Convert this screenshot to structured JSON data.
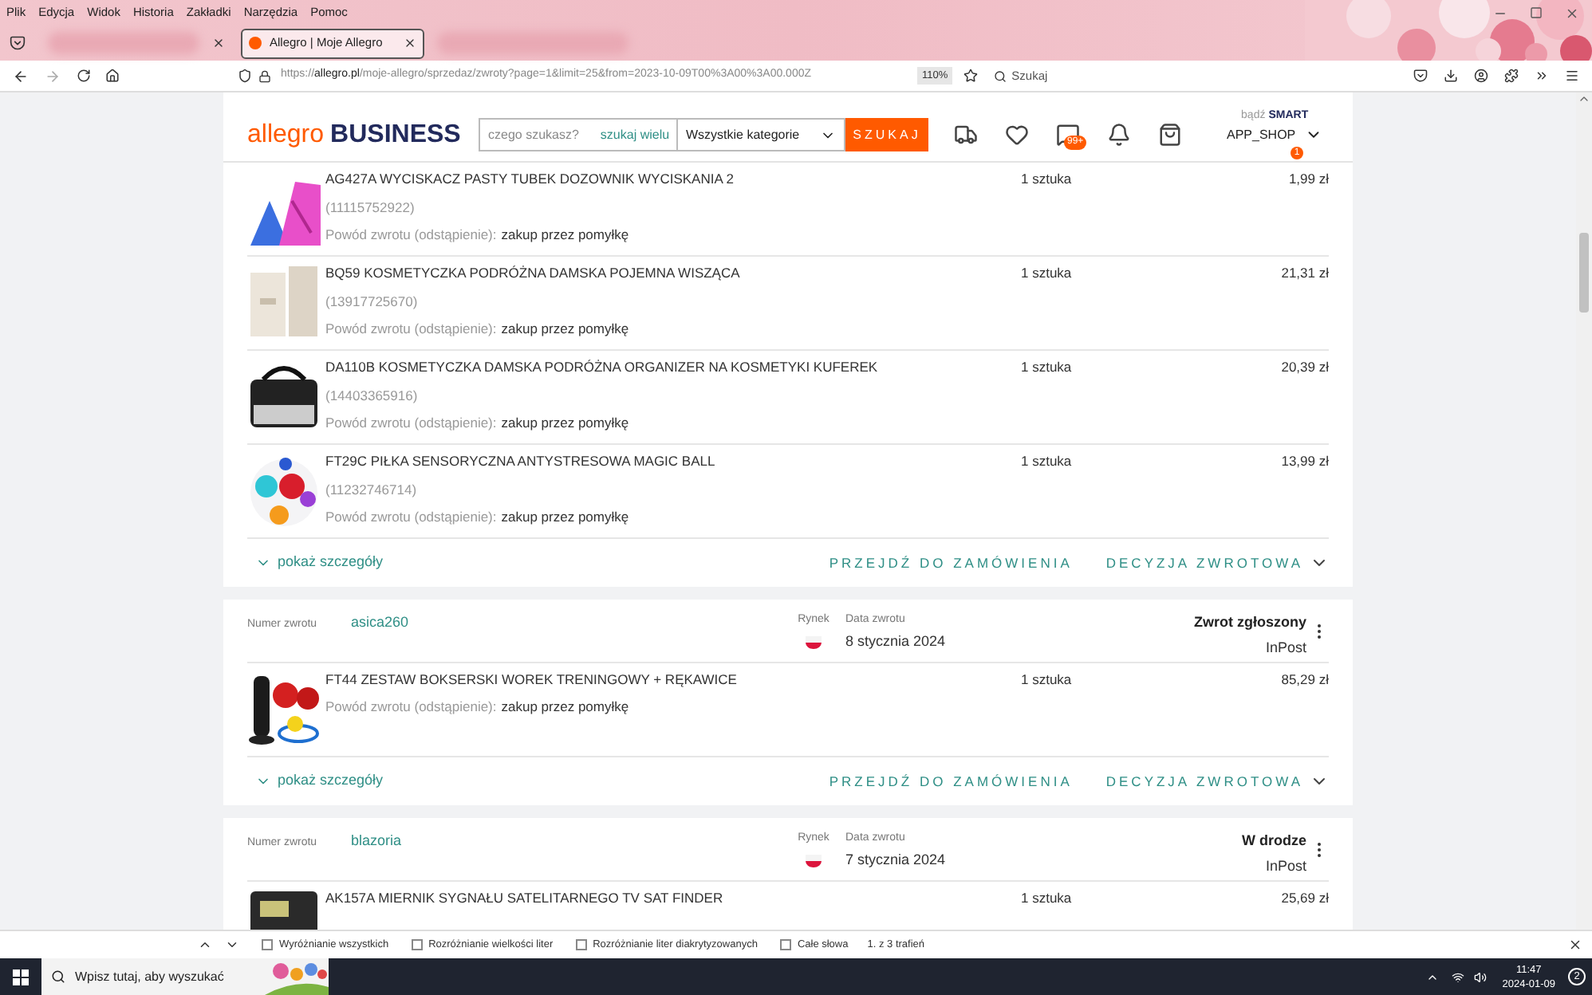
{
  "browser": {
    "menu": [
      "Plik",
      "Edycja",
      "Widok",
      "Historia",
      "Zakładki",
      "Narzędzia",
      "Pomoc"
    ],
    "tabs": [
      {
        "title": "Allegro | Moje Allegro",
        "selected": true
      }
    ],
    "url": {
      "scheme": "https://",
      "domain": "allegro.pl",
      "path": "/moje-allegro/sprzedaz/zwroty?page=1&limit=25&from=2023-10-09T00%3A00%3A00.000Z"
    },
    "zoom": "110%",
    "search_placeholder": "Szukaj"
  },
  "header": {
    "logo": "allegro",
    "logo_suffix": "BUSINESS",
    "search": {
      "placeholder": "czego szukasz?"
    },
    "search_many": "szukaj wielu",
    "category": "Wszystkie kategorie",
    "search_button": "SZUKAJ",
    "messages_badge": "99+",
    "smart_prefix": "bądź",
    "smart": "SMART",
    "account": "APP_SHOP",
    "account_badge": "1"
  },
  "returns": [
    {
      "items": [
        {
          "title": "AG427A WYCISKACZ PASTY TUBEK DOZOWNIK WYCISKANIA 2",
          "id": "(11115752922)",
          "reason_label": "Powód zwrotu (odstąpienie):",
          "reason": "zakup przez pomyłkę",
          "quantity": "1 sztuka",
          "price": "1,99 zł"
        },
        {
          "title": "BQ59 KOSMETYCZKA PODRÓŻNA DAMSKA POJEMNA WISZĄCA",
          "id": "(13917725670)",
          "reason_label": "Powód zwrotu (odstąpienie):",
          "reason": "zakup przez pomyłkę",
          "quantity": "1 sztuka",
          "price": "21,31 zł"
        },
        {
          "title": "DA110B KOSMETYCZKA DAMSKA PODRÓŻNA ORGANIZER NA KOSMETYKI KUFEREK",
          "id": "(14403365916)",
          "reason_label": "Powód zwrotu (odstąpienie):",
          "reason": "zakup przez pomyłkę",
          "quantity": "1 sztuka",
          "price": "20,39 zł"
        },
        {
          "title": "FT29C PIŁKA SENSORYCZNA ANTYSTRESOWA MAGIC BALL",
          "id": "(11232746714)",
          "reason_label": "Powód zwrotu (odstąpienie):",
          "reason": "zakup przez pomyłkę",
          "quantity": "1 sztuka",
          "price": "13,99 zł"
        }
      ],
      "footer": {
        "details": "pokaż szczegóły",
        "order_link": "PRZEJDŹ DO ZAMÓWIENIA",
        "decision": "DECYZJA ZWROTOWA"
      }
    },
    {
      "header": {
        "number_label": "Numer zwrotu",
        "number": "asica260",
        "market_label": "Rynek",
        "date_label": "Data zwrotu",
        "date": "8 stycznia 2024",
        "status": "Zwrot zgłoszony",
        "carrier": "InPost"
      },
      "items": [
        {
          "title": "FT44 ZESTAW BOKSERSKI WOREK TRENINGOWY + RĘKAWICE",
          "reason_label": "Powód zwrotu (odstąpienie):",
          "reason": "zakup przez pomyłkę",
          "quantity": "1 sztuka",
          "price": "85,29 zł"
        }
      ],
      "footer": {
        "details": "pokaż szczegóły",
        "order_link": "PRZEJDŹ DO ZAMÓWIENIA",
        "decision": "DECYZJA ZWROTOWA"
      }
    },
    {
      "header": {
        "number_label": "Numer zwrotu",
        "number": "blazoria",
        "market_label": "Rynek",
        "date_label": "Data zwrotu",
        "date": "7 stycznia 2024",
        "status": "W drodze",
        "carrier": "InPost"
      },
      "items": [
        {
          "title": "AK157A MIERNIK SYGNAŁU SATELITARNEGO TV SAT FINDER",
          "quantity": "1 sztuka",
          "price": "25,69 zł"
        }
      ]
    }
  ],
  "find_bar": {
    "options": [
      {
        "label": "Wyróżnianie wszystkich",
        "checked": false
      },
      {
        "label": "Rozróżnianie wielkości liter",
        "checked": false
      },
      {
        "label": "Rozróżnianie liter diakrytyzowanych",
        "checked": false
      },
      {
        "label": "Całe słowa",
        "checked": false
      }
    ],
    "result": "1. z 3 trafień"
  },
  "taskbar": {
    "search_placeholder": "Wpisz tutaj, aby wyszukać",
    "time": "11:47",
    "date": "2024-01-09",
    "notifications": "2"
  }
}
